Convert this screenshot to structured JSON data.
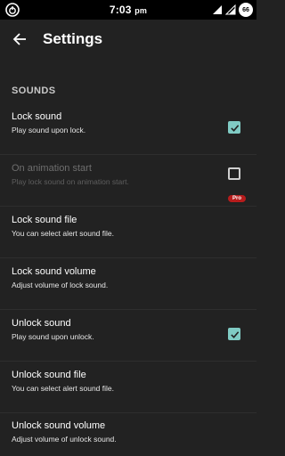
{
  "status_bar": {
    "time": "7:03",
    "ampm": "pm",
    "battery": "66",
    "left_icon": "power-circle-icon",
    "signal_icons": [
      "wifi-icon",
      "signal-icon"
    ]
  },
  "app_bar": {
    "back_icon": "arrow-left-icon",
    "title": "Settings"
  },
  "section": {
    "header": "SOUNDS"
  },
  "preferences": [
    {
      "title": "Lock sound",
      "summary": "Play sound upon lock.",
      "checkbox": "checked",
      "enabled": true
    },
    {
      "title": "On animation start",
      "summary": "Play lock sound on animation start.",
      "checkbox": "unchecked",
      "enabled": false,
      "badge": "Pro"
    },
    {
      "title": "Lock sound file",
      "summary": "You can select alert sound file.",
      "enabled": true
    },
    {
      "title": "Lock sound volume",
      "summary": "Adjust volume of lock sound.",
      "enabled": true
    },
    {
      "title": "Unlock sound",
      "summary": "Play sound upon unlock.",
      "checkbox": "checked",
      "enabled": true
    },
    {
      "title": "Unlock sound file",
      "summary": "You can select alert sound file.",
      "enabled": true
    },
    {
      "title": "Unlock sound volume",
      "summary": "Adjust volume of unlock sound.",
      "enabled": true
    }
  ],
  "colors": {
    "background": "#222222",
    "accent": "#80cbc4",
    "pro_badge": "#b71c1c"
  }
}
